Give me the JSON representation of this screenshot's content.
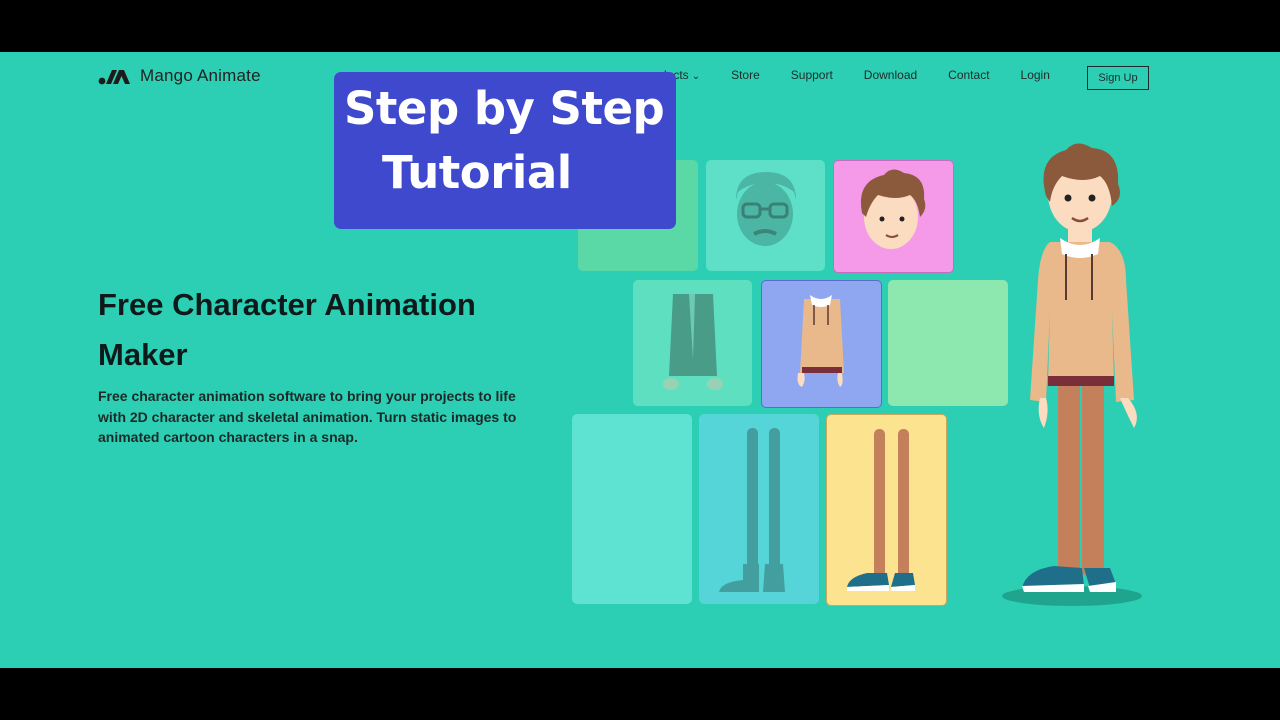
{
  "brand": {
    "name": "Mango Animate"
  },
  "nav": {
    "items": [
      "ducts",
      "Store",
      "Support",
      "Download",
      "Contact",
      "Login"
    ],
    "signup": "Sign Up"
  },
  "overlay": {
    "line1": "Step by Step",
    "line2": "Tutorial"
  },
  "hero": {
    "title": "Free Character Animation Maker",
    "description": "Free character animation software to bring your projects to life with 2D character and skeletal animation. Turn static images to animated cartoon characters in a snap."
  },
  "icons": [
    "mango-logo-icon",
    "chevron-down-icon"
  ],
  "colors": {
    "background": "#2ccfb3",
    "overlay": "#3f49ce",
    "tile_pink": "#f59ae8",
    "tile_blue": "#8ea7f0",
    "tile_yellow": "#fbe38f",
    "tile_green": "#8de8b0",
    "shirt": "#e9b88b",
    "pants": "#c4805a",
    "hair": "#8b5a3c"
  }
}
